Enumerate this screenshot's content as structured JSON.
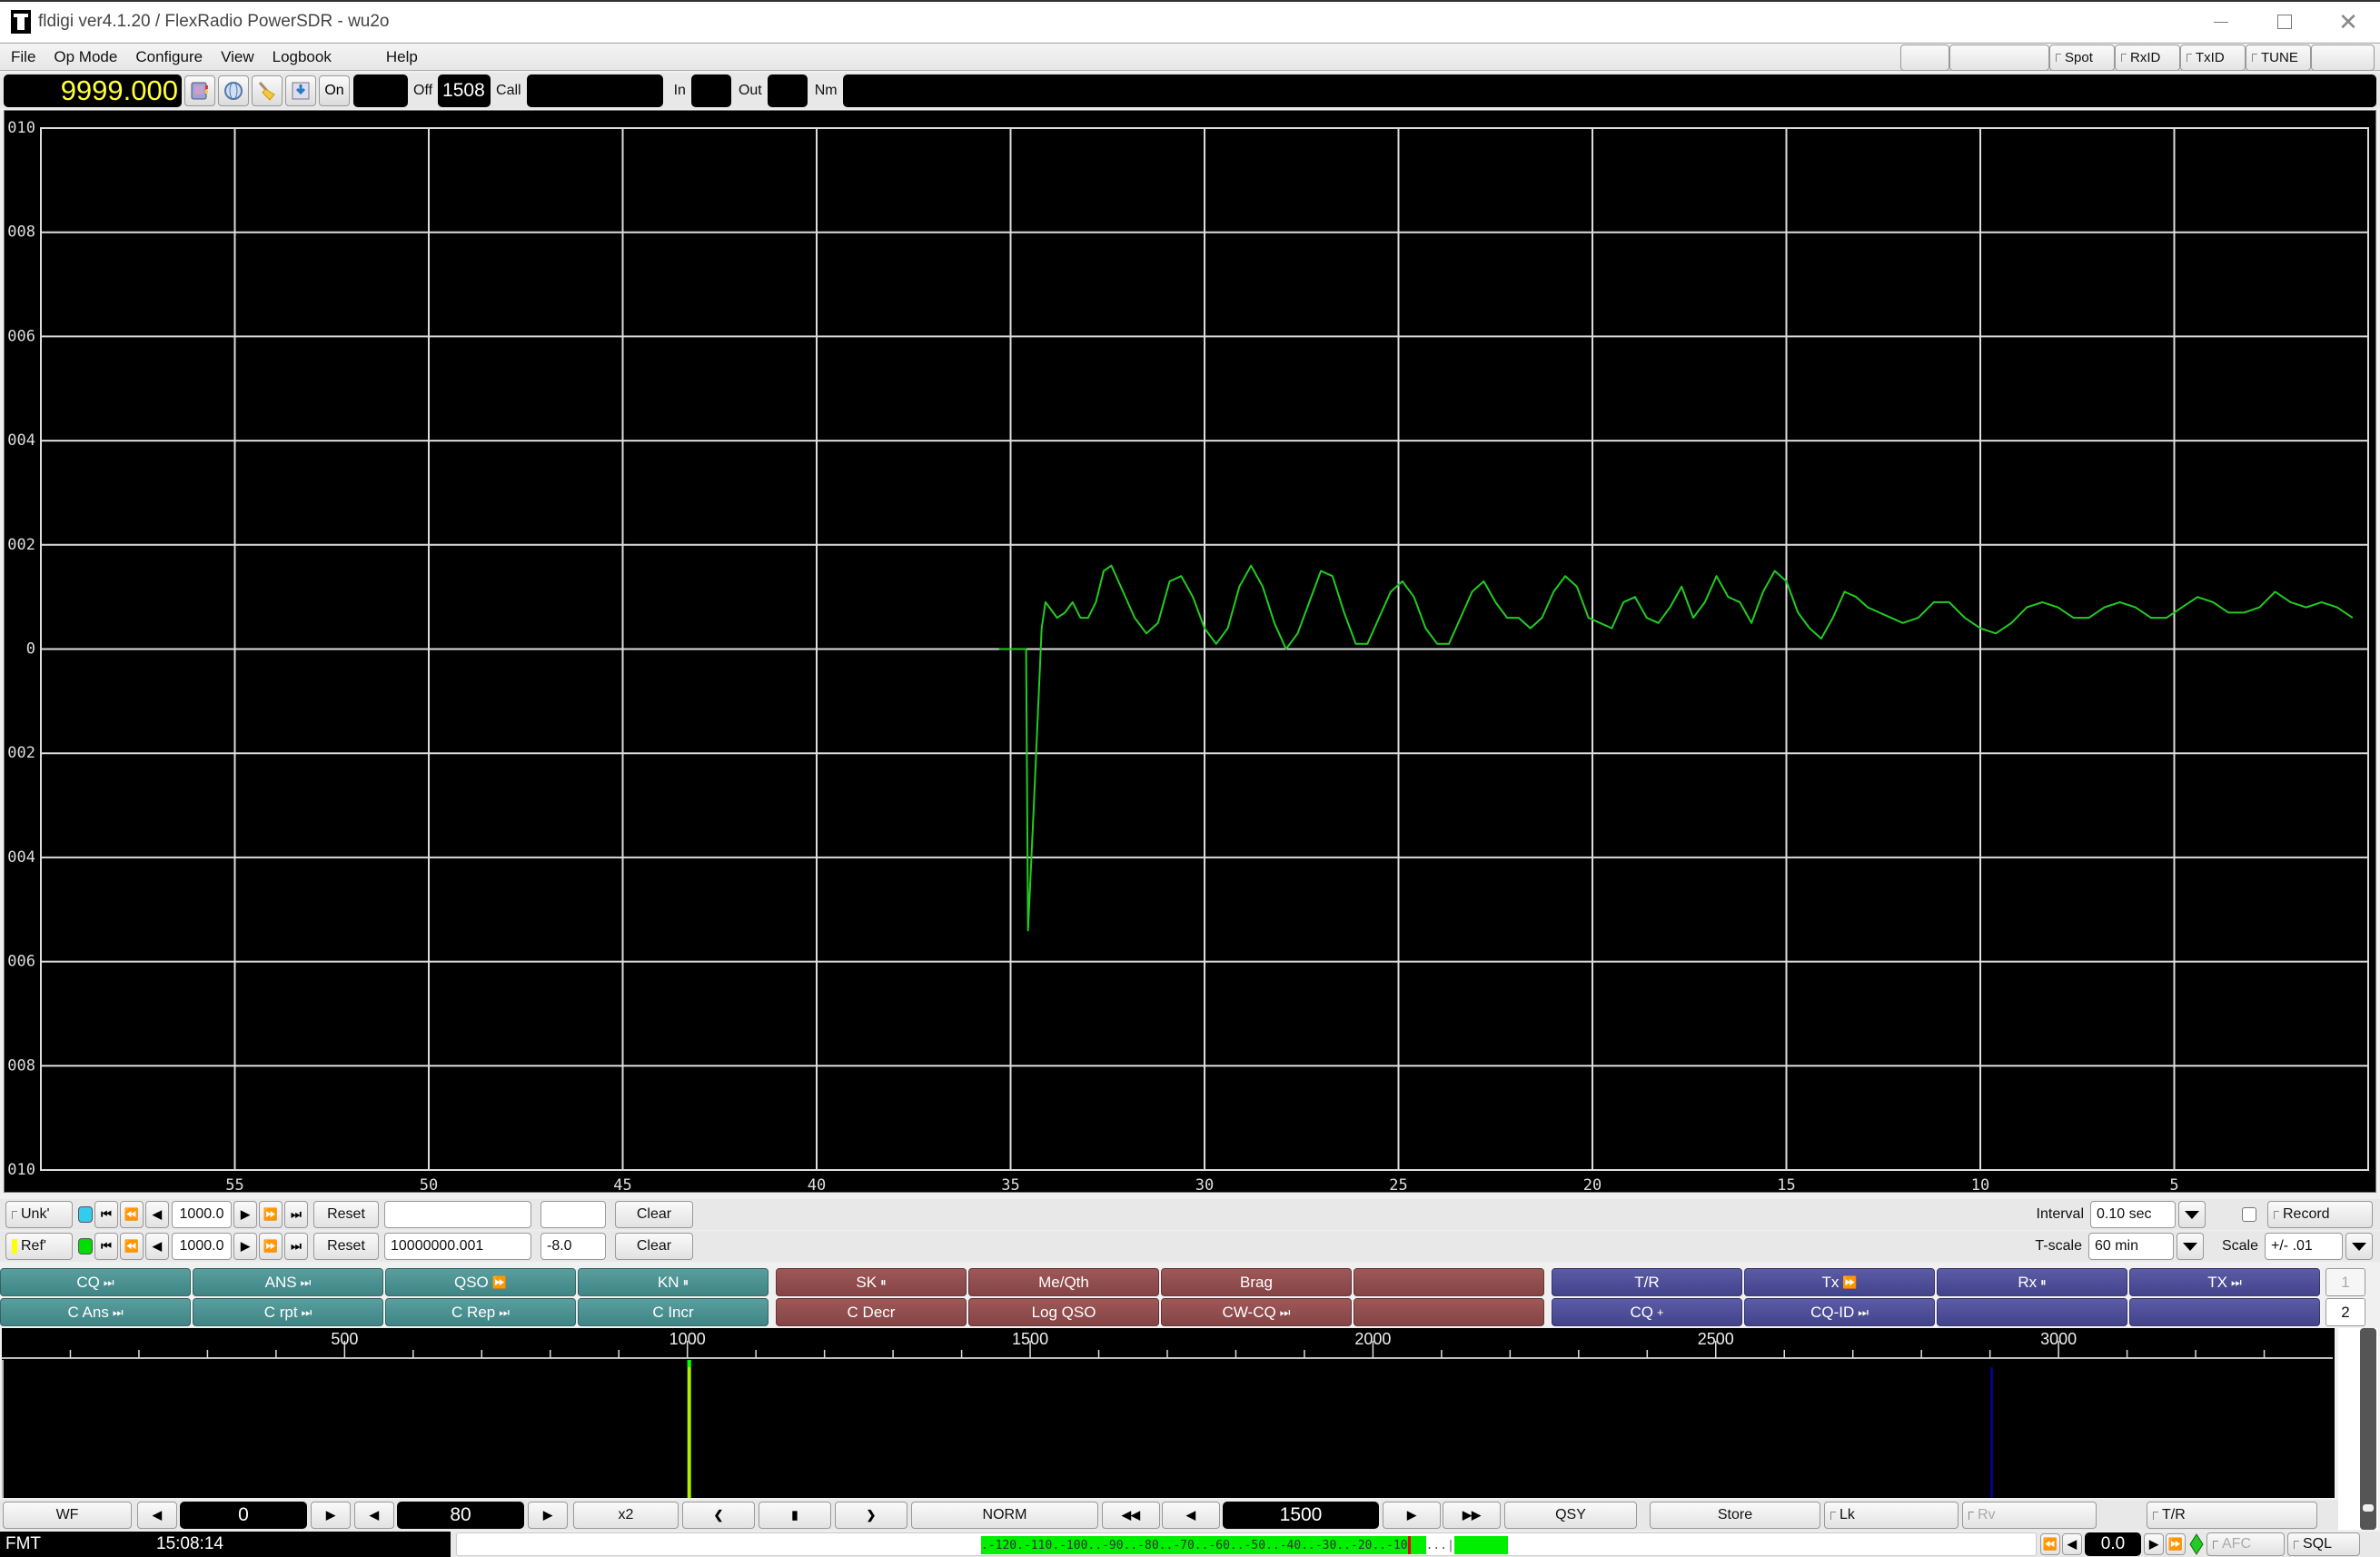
{
  "window": {
    "title": "fldigi ver4.1.20 / FlexRadio PowerSDR - wu2o",
    "controls": [
      "minimize",
      "maximize",
      "close"
    ]
  },
  "menu": {
    "items": [
      "File",
      "Op Mode",
      "Configure",
      "View",
      "Logbook",
      "Help"
    ],
    "toggles": [
      {
        "label": "Spot",
        "checked": false
      },
      {
        "label": "RxID",
        "checked": false
      },
      {
        "label": "TxID",
        "checked": false
      },
      {
        "label": "TUNE",
        "checked": false
      }
    ]
  },
  "toolbar": {
    "frequency": "9999.000",
    "icons": [
      "logbook-icon",
      "globe-icon",
      "broom-icon",
      "save-icon"
    ],
    "on_label": "On",
    "on_value": "",
    "off_label": "Off",
    "off_value": "1508",
    "call_label": "Call",
    "call_value": "",
    "in_label": "In",
    "in_value": "",
    "out_label": "Out",
    "out_value": "",
    "name_label": "Nm",
    "name_value": ""
  },
  "chart_data": {
    "type": "line",
    "title": "",
    "xlabel": "",
    "ylabel": "",
    "x_reversed": true,
    "xlim": [
      60,
      0
    ],
    "ylim": [
      -0.01,
      0.01
    ],
    "grid": true,
    "x_ticks": [
      "55",
      "50",
      "45",
      "40",
      "35",
      "30",
      "25",
      "20",
      "15",
      "10",
      "5"
    ],
    "x_tick_values": [
      55,
      50,
      45,
      40,
      35,
      30,
      25,
      20,
      15,
      10,
      5
    ],
    "y_ticks": [
      ".010",
      ".008",
      ".006",
      ".004",
      ".002",
      "0",
      "-.002",
      "-.004",
      "-.006",
      "-.008",
      "-.010"
    ],
    "y_tick_values": [
      0.01,
      0.008,
      0.006,
      0.004,
      0.002,
      0,
      -0.002,
      -0.004,
      -0.006,
      -0.008,
      -0.01
    ],
    "series": [
      {
        "name": "Unk",
        "color": "#22cc22",
        "x": [
          35.3,
          34.6,
          34.55,
          34.4,
          34.2,
          34.1,
          34.0,
          33.8,
          33.6,
          33.4,
          33.2,
          33.0,
          32.8,
          32.6,
          32.4,
          32.1,
          31.8,
          31.5,
          31.2,
          30.9,
          30.6,
          30.3,
          30.0,
          29.7,
          29.4,
          29.1,
          28.8,
          28.5,
          28.2,
          27.9,
          27.6,
          27.3,
          27.0,
          26.7,
          26.4,
          26.1,
          25.8,
          25.5,
          25.2,
          24.9,
          24.6,
          24.3,
          24.0,
          23.7,
          23.4,
          23.1,
          22.8,
          22.5,
          22.2,
          21.9,
          21.6,
          21.3,
          21.0,
          20.7,
          20.4,
          20.1,
          19.8,
          19.5,
          19.2,
          18.9,
          18.6,
          18.3,
          18.0,
          17.7,
          17.4,
          17.1,
          16.8,
          16.5,
          16.2,
          15.9,
          15.6,
          15.3,
          15.0,
          14.7,
          14.4,
          14.1,
          13.8,
          13.5,
          13.2,
          12.9,
          12.6,
          12.3,
          12.0,
          11.6,
          11.2,
          10.8,
          10.4,
          10.0,
          9.6,
          9.2,
          8.8,
          8.4,
          8.0,
          7.6,
          7.2,
          6.8,
          6.4,
          6.0,
          5.6,
          5.2,
          4.8,
          4.4,
          4.0,
          3.6,
          3.2,
          2.8,
          2.4,
          2.0,
          1.6,
          1.2,
          0.8,
          0.4,
          0.0
        ],
        "y": [
          0.0,
          0.0,
          -0.0054,
          -0.003,
          0.0004,
          0.0009,
          0.0008,
          0.0006,
          0.0007,
          0.0009,
          0.0006,
          0.0006,
          0.0009,
          0.0015,
          0.0016,
          0.0011,
          0.0006,
          0.0003,
          0.0005,
          0.0013,
          0.0014,
          0.001,
          0.0004,
          0.0001,
          0.0004,
          0.0012,
          0.0016,
          0.0012,
          0.0005,
          0.0,
          0.0003,
          0.0009,
          0.0015,
          0.0014,
          0.0007,
          0.0001,
          0.0001,
          0.0006,
          0.0011,
          0.0013,
          0.001,
          0.0004,
          0.0001,
          0.0001,
          0.0006,
          0.0011,
          0.0013,
          0.0009,
          0.0006,
          0.0006,
          0.0004,
          0.0006,
          0.0011,
          0.0014,
          0.0012,
          0.0006,
          0.0005,
          0.0004,
          0.0009,
          0.001,
          0.0006,
          0.0005,
          0.0008,
          0.0012,
          0.0006,
          0.0009,
          0.0014,
          0.001,
          0.0009,
          0.0005,
          0.0011,
          0.0015,
          0.0013,
          0.0007,
          0.0004,
          0.0002,
          0.0006,
          0.0011,
          0.001,
          0.0008,
          0.0007,
          0.0006,
          0.0005,
          0.0006,
          0.0009,
          0.0009,
          0.0006,
          0.0004,
          0.0003,
          0.0005,
          0.0008,
          0.0009,
          0.0008,
          0.0006,
          0.0006,
          0.0008,
          0.0009,
          0.0008,
          0.0006,
          0.0006,
          0.0008,
          0.001,
          0.0009,
          0.0007,
          0.0007,
          0.0008,
          0.0011,
          0.0009,
          0.0008,
          0.0009,
          0.0008,
          0.0006
        ]
      }
    ]
  },
  "unk_row": {
    "toggle_label": "Unk'",
    "led_color": "#33ccee",
    "step_value": "1000.0",
    "reset_label": "Reset",
    "value_1": "",
    "value_2": "",
    "clear_label": "Clear",
    "interval_label": "Interval",
    "interval_value": "0.10 sec",
    "record_checked": false,
    "record_label": "Record"
  },
  "ref_row": {
    "toggle_label": "Ref'",
    "toggle_indicator_color": "#ffff00",
    "led_color": "#00dd00",
    "step_value": "1000.0",
    "reset_label": "Reset",
    "value_1": "10000000.001",
    "value_2": "-8.0",
    "clear_label": "Clear",
    "tscale_label": "T-scale",
    "tscale_value": "60  min",
    "scale_label": "Scale",
    "scale_value": "+/- .01"
  },
  "macros": {
    "row1": [
      {
        "label": "CQ",
        "icon": "end",
        "group": "teal"
      },
      {
        "label": "ANS",
        "icon": "end",
        "group": "teal"
      },
      {
        "label": "QSO",
        "icon": "ff",
        "group": "teal"
      },
      {
        "label": "KN",
        "icon": "pause",
        "group": "teal"
      },
      {
        "label": "SK",
        "icon": "pause",
        "group": "red"
      },
      {
        "label": "Me/Qth",
        "icon": "",
        "group": "red"
      },
      {
        "label": "Brag",
        "icon": "",
        "group": "red"
      },
      {
        "label": "",
        "icon": "",
        "group": "red"
      },
      {
        "label": "T/R",
        "icon": "",
        "group": "blue"
      },
      {
        "label": "Tx",
        "icon": "ff",
        "group": "blue"
      },
      {
        "label": "Rx",
        "icon": "pause",
        "group": "blue"
      },
      {
        "label": "TX",
        "icon": "end",
        "group": "blue"
      }
    ],
    "row2": [
      {
        "label": "C Ans",
        "icon": "end",
        "group": "teal"
      },
      {
        "label": "C rpt",
        "icon": "end",
        "group": "teal"
      },
      {
        "label": "C Rep",
        "icon": "end",
        "group": "teal"
      },
      {
        "label": "C Incr",
        "icon": "",
        "group": "teal"
      },
      {
        "label": "C Decr",
        "icon": "",
        "group": "red"
      },
      {
        "label": "Log QSO",
        "icon": "",
        "group": "red"
      },
      {
        "label": "CW-CQ",
        "icon": "end",
        "group": "red"
      },
      {
        "label": "",
        "icon": "",
        "group": "red"
      },
      {
        "label": "CQ",
        "icon": "plus",
        "group": "blue"
      },
      {
        "label": "CQ-ID",
        "icon": "end",
        "group": "blue"
      },
      {
        "label": "",
        "icon": "",
        "group": "blue"
      },
      {
        "label": "",
        "icon": "",
        "group": "blue"
      }
    ],
    "set_selectors": [
      "1",
      "2"
    ],
    "active_set": "2",
    "colors": {
      "teal": "#4a9090",
      "red": "#8f4c4c",
      "blue": "#4e4e98"
    }
  },
  "waterfall": {
    "scale_labels": [
      "500",
      "1000",
      "1500",
      "2000",
      "2500",
      "3000"
    ],
    "scale_values": [
      500,
      1000,
      1500,
      2000,
      2500,
      3000
    ],
    "freq_range": [
      0,
      3400
    ],
    "cursor_freq": 1000,
    "cursor_color": "#aaee00",
    "marker_freq": 2900,
    "marker_color": "#0000cc"
  },
  "bottom_controls": {
    "wf_label": "WF",
    "offset_value": "0",
    "range_value": "80",
    "zoom_label": "x2",
    "mode_label": "NORM",
    "carrier_freq": "1500",
    "qsy_label": "QSY",
    "store_label": "Store",
    "lock_label": "Lk",
    "rev_label": "Rv",
    "tr_label": "T/R"
  },
  "status_bar": {
    "mode": "FMT",
    "time": "15:08:14",
    "signal_meter_scale": ".-120.-110.-100..-90..-80..-70..-60..-50..-40..-30..-20..-10",
    "signal_meter_tail": "...|",
    "meter_color": "#00ee00",
    "tuning_offset": "0.0",
    "afc_label": "AFC",
    "sql_label": "SQL",
    "sql_indicator_color": "#22cc22"
  }
}
